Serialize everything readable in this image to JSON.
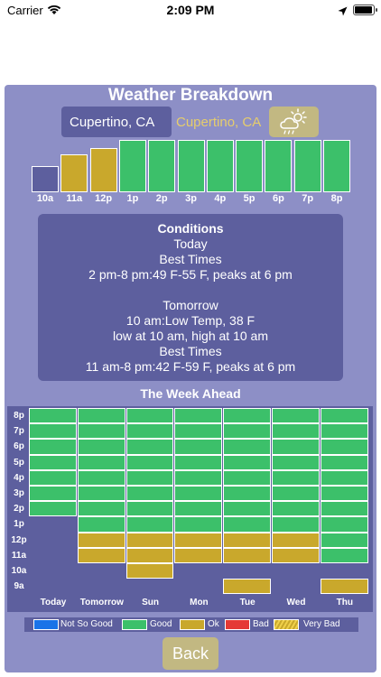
{
  "status_bar": {
    "carrier": "Carrier",
    "time": "2:09 PM"
  },
  "header": {
    "title": "Weather Breakdown",
    "city_selected": "Cupertino, CA",
    "city_alt": "Cupertino, CA",
    "weather_icon": "partly-cloudy-rain-icon"
  },
  "colors": {
    "not_so_good": "#1a73e8",
    "good": "#3cc06a",
    "ok": "#c9a82c",
    "bad": "#e53935",
    "very_bad": "#f0d04a",
    "empty": "#5d5f9e"
  },
  "hourly": [
    {
      "label": "10a",
      "rating": "empty",
      "level": 0.5
    },
    {
      "label": "11a",
      "rating": "ok",
      "level": 0.72
    },
    {
      "label": "12p",
      "rating": "ok",
      "level": 0.85
    },
    {
      "label": "1p",
      "rating": "good",
      "level": 1.0
    },
    {
      "label": "2p",
      "rating": "good",
      "level": 1.0
    },
    {
      "label": "3p",
      "rating": "good",
      "level": 1.0
    },
    {
      "label": "4p",
      "rating": "good",
      "level": 1.0
    },
    {
      "label": "5p",
      "rating": "good",
      "level": 1.0
    },
    {
      "label": "6p",
      "rating": "good",
      "level": 1.0
    },
    {
      "label": "7p",
      "rating": "good",
      "level": 1.0
    },
    {
      "label": "8p",
      "rating": "good",
      "level": 1.0
    }
  ],
  "conditions": {
    "heading": "Conditions",
    "today_label": "Today",
    "today_best_label": "Best Times",
    "today_best": "2 pm-8 pm:49 F-55 F, peaks at 6 pm",
    "tomorrow_label": "Tomorrow",
    "tomorrow_low": "10 am:Low Temp, 38 F",
    "tomorrow_range": "low at 10 am, high at 10 am",
    "tomorrow_best_label": "Best Times",
    "tomorrow_best": "11 am-8 pm:42 F-59 F, peaks at 6 pm"
  },
  "week": {
    "title": "The Week Ahead",
    "hours": [
      "8p",
      "7p",
      "6p",
      "5p",
      "4p",
      "3p",
      "2p",
      "1p",
      "12p",
      "11a",
      "10a",
      "9a"
    ],
    "days": [
      "Today",
      "Tomorrow",
      "Sun",
      "Mon",
      "Tue",
      "Wed",
      "Thu"
    ],
    "grid": [
      [
        "good",
        "good",
        "good",
        "good",
        "good",
        "good",
        "good"
      ],
      [
        "good",
        "good",
        "good",
        "good",
        "good",
        "good",
        "good"
      ],
      [
        "good",
        "good",
        "good",
        "good",
        "good",
        "good",
        "good"
      ],
      [
        "good",
        "good",
        "good",
        "good",
        "good",
        "good",
        "good"
      ],
      [
        "good",
        "good",
        "good",
        "good",
        "good",
        "good",
        "good"
      ],
      [
        "good",
        "good",
        "good",
        "good",
        "good",
        "good",
        "good"
      ],
      [
        "good",
        "good",
        "good",
        "good",
        "good",
        "good",
        "good"
      ],
      [
        "empty",
        "good",
        "good",
        "good",
        "good",
        "good",
        "good"
      ],
      [
        "empty",
        "ok",
        "ok",
        "ok",
        "ok",
        "ok",
        "good"
      ],
      [
        "empty",
        "ok",
        "ok",
        "ok",
        "ok",
        "ok",
        "good"
      ],
      [
        "empty",
        "empty",
        "ok",
        "empty",
        "empty",
        "empty",
        "empty"
      ],
      [
        "empty",
        "empty",
        "empty",
        "empty",
        "ok",
        "empty",
        "ok"
      ]
    ]
  },
  "legend": [
    {
      "label": "Not So Good",
      "rating": "not_so_good"
    },
    {
      "label": "Good",
      "rating": "good"
    },
    {
      "label": "Ok",
      "rating": "ok"
    },
    {
      "label": "Bad",
      "rating": "bad"
    },
    {
      "label": "Very Bad",
      "rating": "very_bad"
    }
  ],
  "back_label": "Back"
}
